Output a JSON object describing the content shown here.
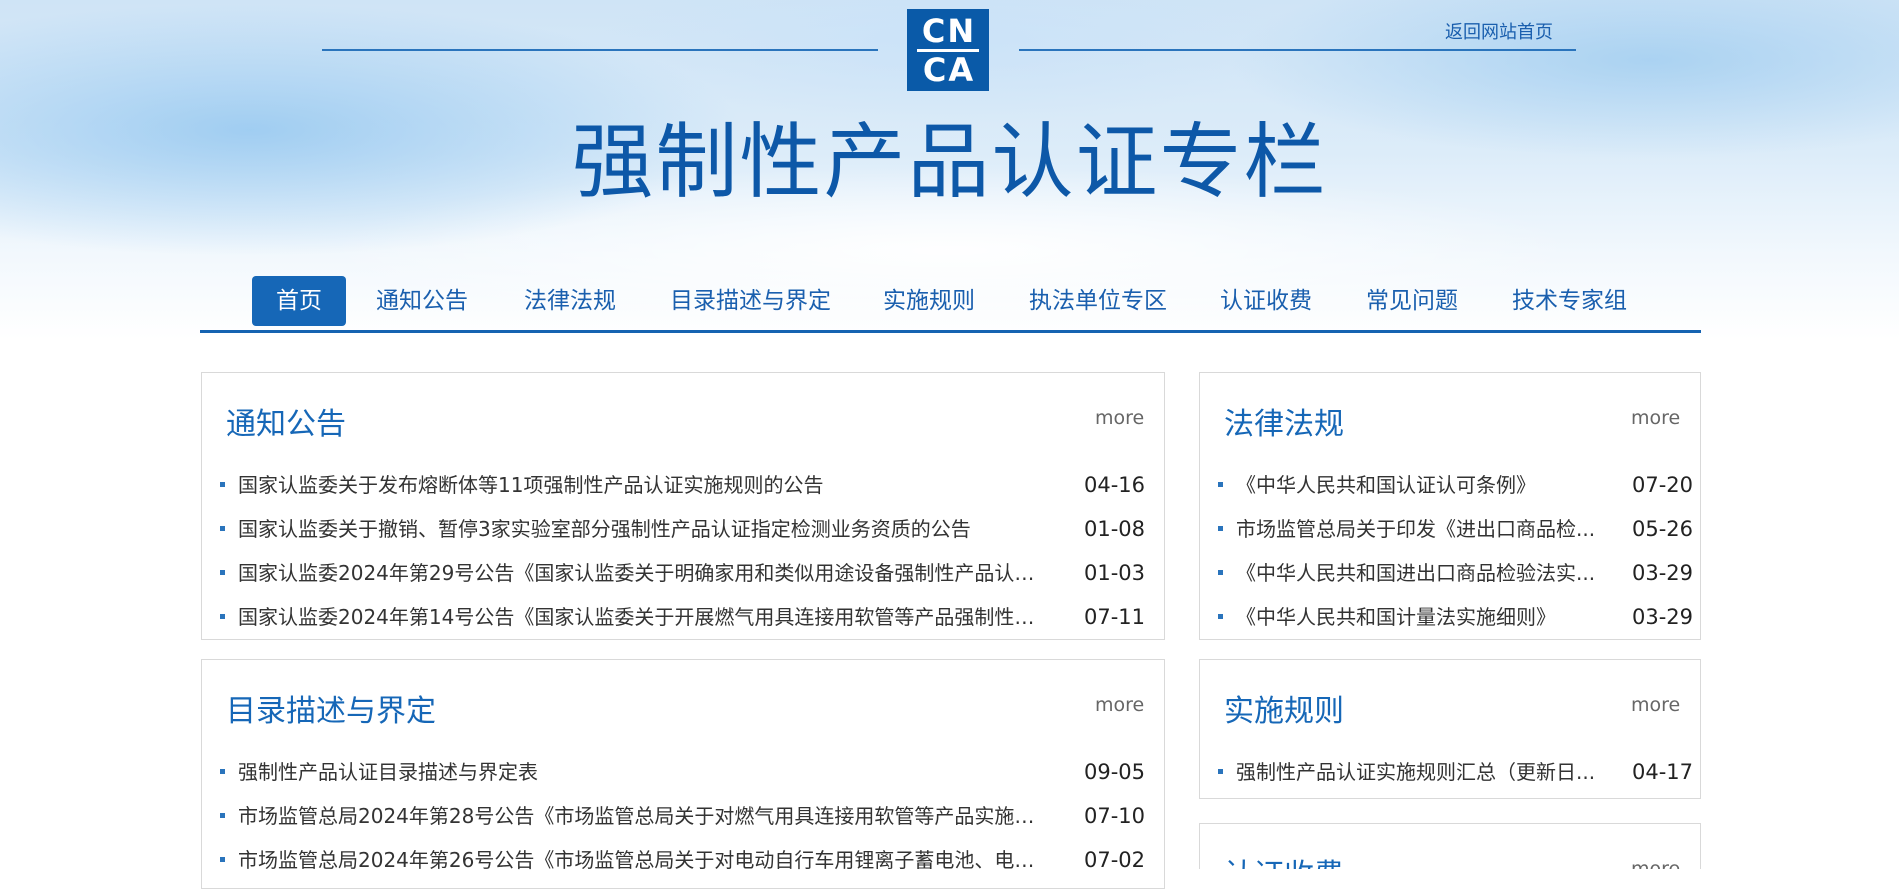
{
  "header": {
    "logo_letters": [
      "C",
      "N",
      "C",
      "A"
    ],
    "home_link": "返回网站首页",
    "title": "强制性产品认证专栏"
  },
  "nav": [
    {
      "label": "首页",
      "active": true
    },
    {
      "label": "通知公告"
    },
    {
      "label": "法律法规"
    },
    {
      "label": "目录描述与界定"
    },
    {
      "label": "实施规则"
    },
    {
      "label": "执法单位专区"
    },
    {
      "label": "认证收费"
    },
    {
      "label": "常见问题"
    },
    {
      "label": "技术专家组"
    }
  ],
  "panels": {
    "notices": {
      "title": "通知公告",
      "more": "more",
      "items": [
        {
          "title": "国家认监委关于发布熔断体等11项强制性产品认证实施规则的公告",
          "date": "04-16"
        },
        {
          "title": "国家认监委关于撤销、暂停3家实验室部分强制性产品认证指定检测业务资质的公告",
          "date": "01-08"
        },
        {
          "title": "国家认监委2024年第29号公告《国家认监委关于明确家用和类似用途设备强制性产品认证...",
          "date": "01-03"
        },
        {
          "title": "国家认监委2024年第14号公告《国家认监委关于开展燃气用具连接用软管等产品强制性产...",
          "date": "07-11"
        }
      ]
    },
    "laws": {
      "title": "法律法规",
      "more": "more",
      "items": [
        {
          "title": "《中华人民共和国认证认可条例》",
          "date": "07-20"
        },
        {
          "title": "市场监管总局关于印发《进出口商品检...",
          "date": "05-26"
        },
        {
          "title": "《中华人民共和国进出口商品检验法实...",
          "date": "03-29"
        },
        {
          "title": "《中华人民共和国计量法实施细则》",
          "date": "03-29"
        }
      ]
    },
    "catalog": {
      "title": "目录描述与界定",
      "more": "more",
      "items": [
        {
          "title": "强制性产品认证目录描述与界定表",
          "date": "09-05"
        },
        {
          "title": "市场监管总局2024年第28号公告《市场监管总局关于对燃气用具连接用软管等产品实施强...",
          "date": "07-10"
        },
        {
          "title": "市场监管总局2024年第26号公告《市场监管总局关于对电动自行车用锂离子蓄电池、电动...",
          "date": "07-02"
        }
      ]
    },
    "rules": {
      "title": "实施规则",
      "more": "more",
      "items": [
        {
          "title": "强制性产品认证实施规则汇总（更新日...",
          "date": "04-17"
        }
      ]
    },
    "fees": {
      "title": "认证收费",
      "more": "more"
    }
  }
}
